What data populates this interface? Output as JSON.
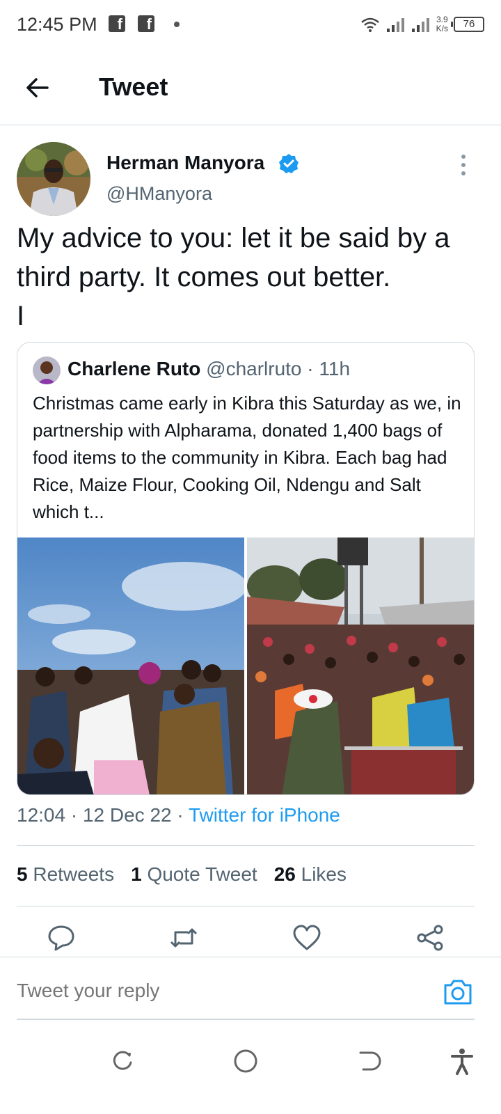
{
  "status_bar": {
    "time": "12:45 PM",
    "notif_icons": [
      "facebook-icon",
      "facebook-icon"
    ],
    "speed": "3.9",
    "speed_unit": "K/s",
    "battery": "76"
  },
  "header": {
    "title": "Tweet"
  },
  "tweet": {
    "author_name": "Herman Manyora",
    "author_handle": "@HManyora",
    "text": "My advice to you: let it be said by a third party. It comes out better.\nI",
    "time": "12:04",
    "date": "12 Dec 22",
    "source": "Twitter for iPhone",
    "separator": " · "
  },
  "quoted_tweet": {
    "author_name": "Charlene Ruto",
    "author_handle": "@charlruto",
    "age": "11h",
    "text": "Christmas came early in Kibra this Saturday as we, in partnership with Alpharama, donated 1,400 bags of food items to the community in Kibra. Each bag had Rice, Maize Flour, Cooking Oil, Ndengu and Salt which t..."
  },
  "stats": [
    {
      "count": "5",
      "label": "Retweets"
    },
    {
      "count": "1",
      "label": "Quote Tweet"
    },
    {
      "count": "26",
      "label": "Likes"
    }
  ],
  "actions": [
    "reply-icon",
    "retweet-icon",
    "like-icon",
    "share-icon"
  ],
  "reply": {
    "placeholder": "Tweet your reply"
  },
  "colors": {
    "accent": "#1d9bf0",
    "text": "#0f1419",
    "secondary": "#536471",
    "border": "#cfd9de"
  }
}
